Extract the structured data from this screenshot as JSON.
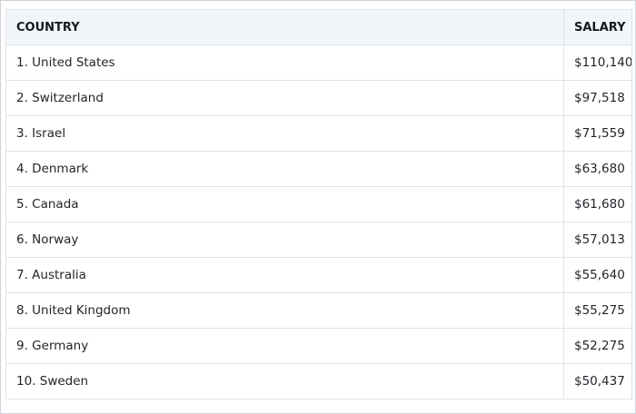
{
  "table": {
    "headers": {
      "country": "COUNTRY",
      "salary": "SALARY"
    },
    "rows": [
      {
        "country": "1. United States",
        "salary": "$110,140"
      },
      {
        "country": "2. Switzerland",
        "salary": "$97,518"
      },
      {
        "country": "3. Israel",
        "salary": "$71,559"
      },
      {
        "country": "4. Denmark",
        "salary": "$63,680"
      },
      {
        "country": "5. Canada",
        "salary": "$61,680"
      },
      {
        "country": "6. Norway",
        "salary": "$57,013"
      },
      {
        "country": "7. Australia",
        "salary": "$55,640"
      },
      {
        "country": "8. United Kingdom",
        "salary": "$55,275"
      },
      {
        "country": "9. Germany",
        "salary": "$52,275"
      },
      {
        "country": "10. Sweden",
        "salary": "$50,437"
      }
    ]
  },
  "colors": {
    "header_background": "#f2f6fa",
    "border": "#dfe3e8",
    "outer_border": "#cfd3d8",
    "text": "#1f2329"
  }
}
